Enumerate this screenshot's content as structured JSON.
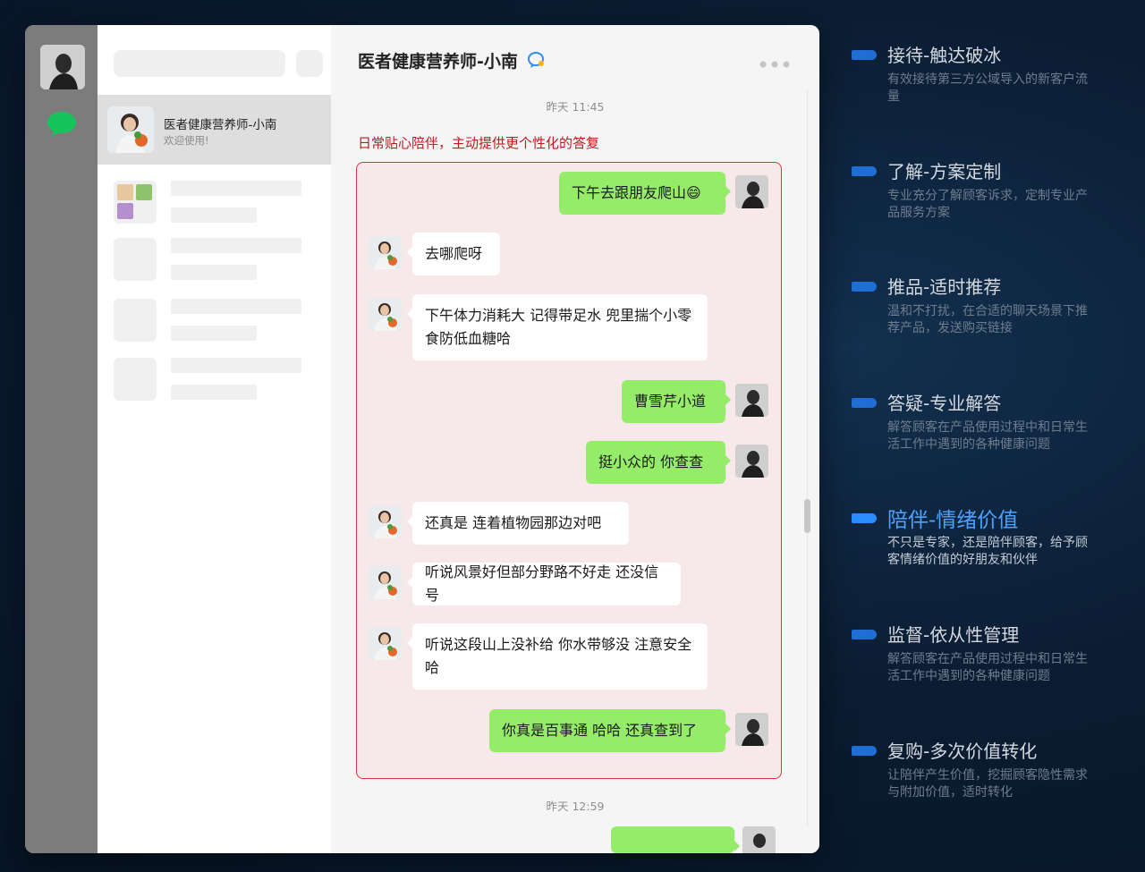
{
  "chat": {
    "title": "医者健康营养师-小南",
    "timestamps": [
      "昨天 11:45",
      "昨天 12:59"
    ],
    "caption": "日常贴心陪伴，主动提供更个性化的答复",
    "messages": [
      {
        "dir": "out",
        "text": "下午去跟朋友爬山😄"
      },
      {
        "dir": "in",
        "text": "去哪爬呀"
      },
      {
        "dir": "in",
        "text": "下午体力消耗大 记得带足水 兜里揣个小零食防低血糖哈"
      },
      {
        "dir": "out",
        "text": "曹雪芹小道"
      },
      {
        "dir": "out",
        "text": "挺小众的 你查查"
      },
      {
        "dir": "in",
        "text": "还真是 连着植物园那边对吧"
      },
      {
        "dir": "in",
        "text": "听说风景好但部分野路不好走 还没信号"
      },
      {
        "dir": "in",
        "text": "听说这段山上没补给 你水带够没 注意安全哈"
      },
      {
        "dir": "out",
        "text": "你真是百事通 哈哈 还真查到了"
      }
    ]
  },
  "conversation_list": {
    "active": {
      "name": "医者健康营养师-小南",
      "preview": "欢迎使用!"
    }
  },
  "steps": [
    {
      "title": "接待-触达破冰",
      "desc": "有效接待第三方公域导入的新客户流量",
      "active": false
    },
    {
      "title": "了解-方案定制",
      "desc": "专业充分了解顾客诉求，定制专业产品服务方案",
      "active": false
    },
    {
      "title": "推品-适时推荐",
      "desc": "温和不打扰，在合适的聊天场景下推荐产品，发送购买链接",
      "active": false
    },
    {
      "title": "答疑-专业解答",
      "desc": "解答顾客在产品使用过程中和日常生活工作中遇到的各种健康问题",
      "active": false
    },
    {
      "title": "陪伴-情绪价值",
      "desc": "不只是专家，还是陪伴顾客，给予顾客情绪价值的好朋友和伙伴",
      "active": true
    },
    {
      "title": "监督-依从性管理",
      "desc": "解答顾客在产品使用过程中和日常生活工作中遇到的各种健康问题",
      "active": false
    },
    {
      "title": "复购-多次价值转化",
      "desc": "让陪伴产生价值，挖掘顾客隐性需求与附加价值，适时转化",
      "active": false
    }
  ],
  "colors": {
    "accent": "#2a8cff",
    "bubble_out": "#95ec69",
    "highlight_border": "#d9363e",
    "caption": "#c8161d"
  }
}
